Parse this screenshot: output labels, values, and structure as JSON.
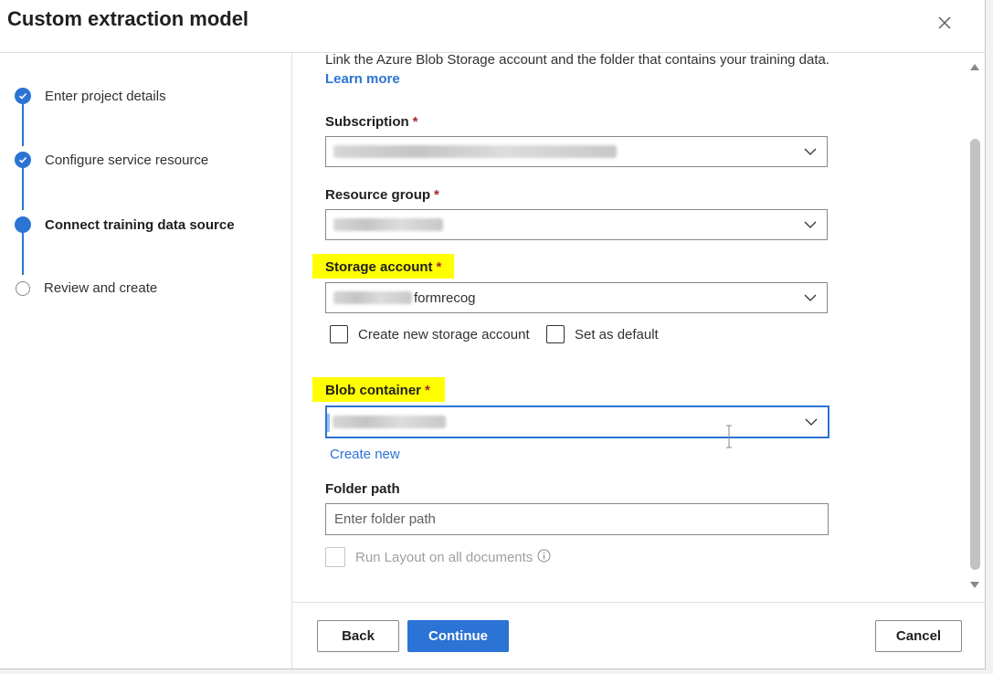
{
  "dialog": {
    "title": "Custom extraction model",
    "close_icon": "close-icon"
  },
  "steps": [
    {
      "label": "Enter project details",
      "status": "completed"
    },
    {
      "label": "Configure service resource",
      "status": "completed"
    },
    {
      "label": "Connect training data source",
      "status": "current"
    },
    {
      "label": "Review and create",
      "status": "pending"
    }
  ],
  "form": {
    "intro_text": "Link the Azure Blob Storage account and the folder that contains your training data.",
    "learn_more": "Learn more",
    "required_mark": "*",
    "subscription": {
      "label": "Subscription"
    },
    "resource_group": {
      "label": "Resource group"
    },
    "storage_account": {
      "label": "Storage account",
      "value_suffix": "formrecog"
    },
    "create_storage_checkbox": "Create new storage account",
    "set_default_checkbox": "Set as default",
    "blob_container": {
      "label": "Blob container"
    },
    "create_new_link": "Create new",
    "folder_path": {
      "label": "Folder path",
      "placeholder": "Enter folder path"
    },
    "run_layout_checkbox": "Run Layout on all documents"
  },
  "footer": {
    "back": "Back",
    "continue": "Continue",
    "cancel": "Cancel"
  },
  "colors": {
    "accent": "#2b73d4",
    "required": "#a4262c",
    "highlight": "#ffff00"
  }
}
